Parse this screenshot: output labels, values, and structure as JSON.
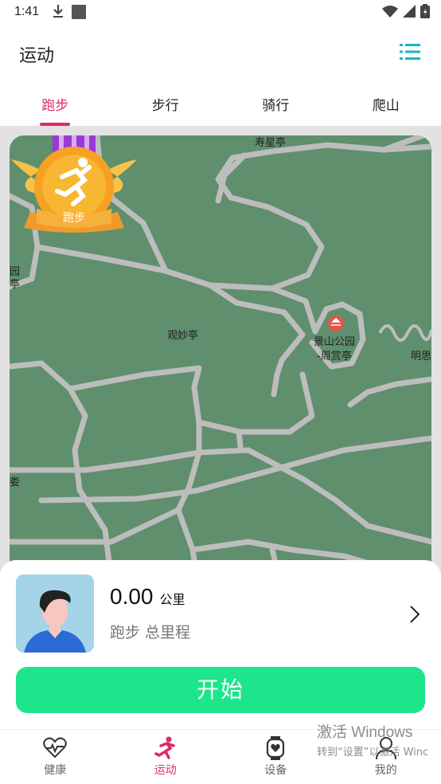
{
  "status_bar": {
    "time": "1:41"
  },
  "header": {
    "title": "运动"
  },
  "tabs": [
    {
      "label": "跑步",
      "active": true
    },
    {
      "label": "步行",
      "active": false
    },
    {
      "label": "骑行",
      "active": false
    },
    {
      "label": "爬山",
      "active": false
    }
  ],
  "map": {
    "labels": {
      "shouxing": "寿星亭",
      "yuan": "园",
      "ting": "亭",
      "guanmiao": "观妙亭",
      "jingshan": "景山公园",
      "zhoushang": "-周赏亭",
      "mingsi": "明思",
      "lou": "娄"
    },
    "medal_label": "跑步"
  },
  "summary": {
    "distance_value": "0.00",
    "distance_unit": "公里",
    "label": "跑步 总里程"
  },
  "start_button": "开始",
  "nav": [
    {
      "label": "健康",
      "icon": "heartbeat-icon",
      "active": false
    },
    {
      "label": "运动",
      "icon": "runner-icon",
      "active": true
    },
    {
      "label": "设备",
      "icon": "watch-icon",
      "active": false
    },
    {
      "label": "我的",
      "icon": "person-icon",
      "active": false
    }
  ],
  "watermark": {
    "line1": "激活 Windows",
    "line2": "转到“设置”以激活 Winc"
  },
  "colors": {
    "accent": "#e0286b",
    "start_button": "#1ee58c",
    "menu_icon": "#1ab6c4",
    "map": "#5f8f6c"
  }
}
